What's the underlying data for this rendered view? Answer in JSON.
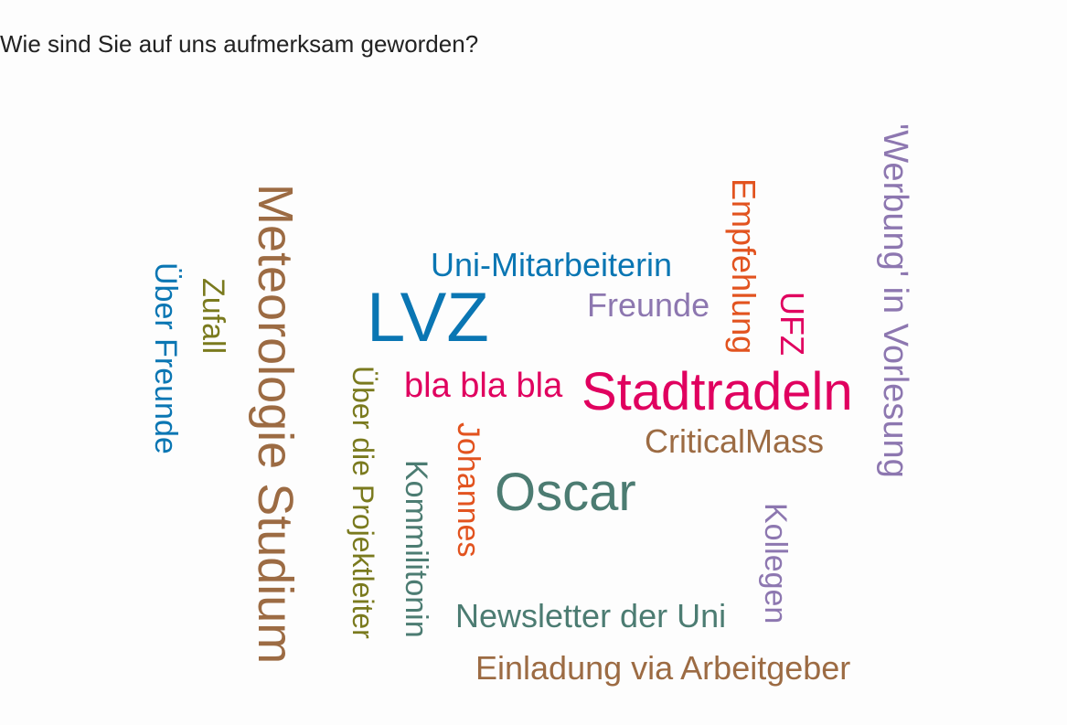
{
  "question": "Wie sind Sie auf uns aufmerksam geworden?",
  "words": [
    {
      "text": "Meteorologie Studium",
      "color": "#9c6b43",
      "orientation": "vertical"
    },
    {
      "text": "LVZ",
      "color": "#0a76b3",
      "orientation": "horizontal"
    },
    {
      "text": "Stadtradeln",
      "color": "#e0005f",
      "orientation": "horizontal"
    },
    {
      "text": "Oscar",
      "color": "#4c7c72",
      "orientation": "horizontal"
    },
    {
      "text": "Über die Projektleiter",
      "color": "#7a7a1e",
      "orientation": "vertical"
    },
    {
      "text": "'Werbung' in Vorlesung",
      "color": "#8d77b0",
      "orientation": "vertical"
    },
    {
      "text": "Uni-Mitarbeiterin",
      "color": "#0a76b3",
      "orientation": "horizontal"
    },
    {
      "text": "Empfehlung",
      "color": "#e2531f",
      "orientation": "vertical"
    },
    {
      "text": "Freunde",
      "color": "#8d77b0",
      "orientation": "horizontal"
    },
    {
      "text": "UFZ",
      "color": "#e0005f",
      "orientation": "vertical"
    },
    {
      "text": "bla bla bla",
      "color": "#e0005f",
      "orientation": "horizontal"
    },
    {
      "text": "CriticalMass",
      "color": "#9c6b43",
      "orientation": "horizontal"
    },
    {
      "text": "Über Freunde",
      "color": "#0a76b3",
      "orientation": "vertical"
    },
    {
      "text": "Zufall",
      "color": "#7a7a1e",
      "orientation": "vertical"
    },
    {
      "text": "Johannes",
      "color": "#e2531f",
      "orientation": "vertical"
    },
    {
      "text": "Kommilitonin",
      "color": "#4c7c72",
      "orientation": "vertical"
    },
    {
      "text": "Kollegen",
      "color": "#8d77b0",
      "orientation": "vertical"
    },
    {
      "text": "Newsletter der Uni",
      "color": "#4c7c72",
      "orientation": "horizontal"
    },
    {
      "text": "Einladung via Arbeitgeber",
      "color": "#9c6b43",
      "orientation": "horizontal"
    }
  ]
}
